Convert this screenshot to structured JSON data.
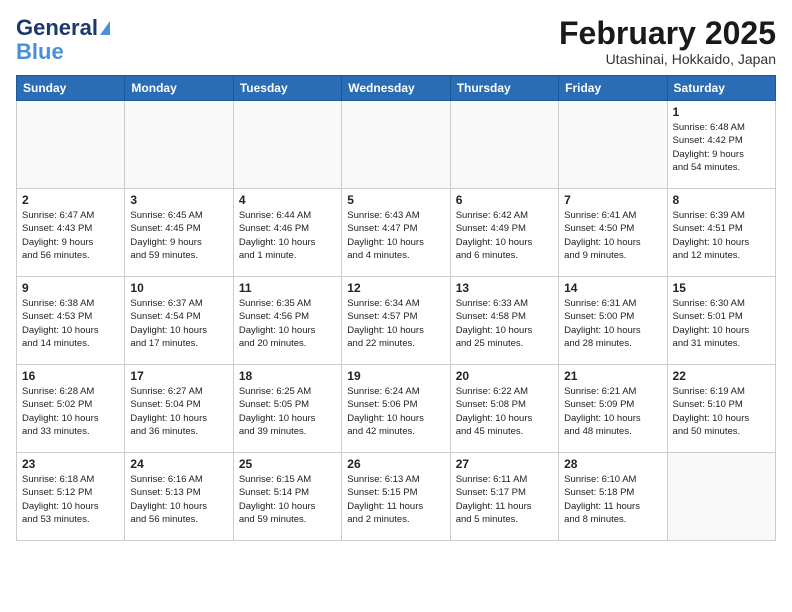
{
  "header": {
    "logo_line1": "General",
    "logo_line2": "Blue",
    "month_title": "February 2025",
    "location": "Utashinai, Hokkaido, Japan"
  },
  "days_of_week": [
    "Sunday",
    "Monday",
    "Tuesday",
    "Wednesday",
    "Thursday",
    "Friday",
    "Saturday"
  ],
  "weeks": [
    [
      {
        "day": "",
        "info": ""
      },
      {
        "day": "",
        "info": ""
      },
      {
        "day": "",
        "info": ""
      },
      {
        "day": "",
        "info": ""
      },
      {
        "day": "",
        "info": ""
      },
      {
        "day": "",
        "info": ""
      },
      {
        "day": "1",
        "info": "Sunrise: 6:48 AM\nSunset: 4:42 PM\nDaylight: 9 hours\nand 54 minutes."
      }
    ],
    [
      {
        "day": "2",
        "info": "Sunrise: 6:47 AM\nSunset: 4:43 PM\nDaylight: 9 hours\nand 56 minutes."
      },
      {
        "day": "3",
        "info": "Sunrise: 6:45 AM\nSunset: 4:45 PM\nDaylight: 9 hours\nand 59 minutes."
      },
      {
        "day": "4",
        "info": "Sunrise: 6:44 AM\nSunset: 4:46 PM\nDaylight: 10 hours\nand 1 minute."
      },
      {
        "day": "5",
        "info": "Sunrise: 6:43 AM\nSunset: 4:47 PM\nDaylight: 10 hours\nand 4 minutes."
      },
      {
        "day": "6",
        "info": "Sunrise: 6:42 AM\nSunset: 4:49 PM\nDaylight: 10 hours\nand 6 minutes."
      },
      {
        "day": "7",
        "info": "Sunrise: 6:41 AM\nSunset: 4:50 PM\nDaylight: 10 hours\nand 9 minutes."
      },
      {
        "day": "8",
        "info": "Sunrise: 6:39 AM\nSunset: 4:51 PM\nDaylight: 10 hours\nand 12 minutes."
      }
    ],
    [
      {
        "day": "9",
        "info": "Sunrise: 6:38 AM\nSunset: 4:53 PM\nDaylight: 10 hours\nand 14 minutes."
      },
      {
        "day": "10",
        "info": "Sunrise: 6:37 AM\nSunset: 4:54 PM\nDaylight: 10 hours\nand 17 minutes."
      },
      {
        "day": "11",
        "info": "Sunrise: 6:35 AM\nSunset: 4:56 PM\nDaylight: 10 hours\nand 20 minutes."
      },
      {
        "day": "12",
        "info": "Sunrise: 6:34 AM\nSunset: 4:57 PM\nDaylight: 10 hours\nand 22 minutes."
      },
      {
        "day": "13",
        "info": "Sunrise: 6:33 AM\nSunset: 4:58 PM\nDaylight: 10 hours\nand 25 minutes."
      },
      {
        "day": "14",
        "info": "Sunrise: 6:31 AM\nSunset: 5:00 PM\nDaylight: 10 hours\nand 28 minutes."
      },
      {
        "day": "15",
        "info": "Sunrise: 6:30 AM\nSunset: 5:01 PM\nDaylight: 10 hours\nand 31 minutes."
      }
    ],
    [
      {
        "day": "16",
        "info": "Sunrise: 6:28 AM\nSunset: 5:02 PM\nDaylight: 10 hours\nand 33 minutes."
      },
      {
        "day": "17",
        "info": "Sunrise: 6:27 AM\nSunset: 5:04 PM\nDaylight: 10 hours\nand 36 minutes."
      },
      {
        "day": "18",
        "info": "Sunrise: 6:25 AM\nSunset: 5:05 PM\nDaylight: 10 hours\nand 39 minutes."
      },
      {
        "day": "19",
        "info": "Sunrise: 6:24 AM\nSunset: 5:06 PM\nDaylight: 10 hours\nand 42 minutes."
      },
      {
        "day": "20",
        "info": "Sunrise: 6:22 AM\nSunset: 5:08 PM\nDaylight: 10 hours\nand 45 minutes."
      },
      {
        "day": "21",
        "info": "Sunrise: 6:21 AM\nSunset: 5:09 PM\nDaylight: 10 hours\nand 48 minutes."
      },
      {
        "day": "22",
        "info": "Sunrise: 6:19 AM\nSunset: 5:10 PM\nDaylight: 10 hours\nand 50 minutes."
      }
    ],
    [
      {
        "day": "23",
        "info": "Sunrise: 6:18 AM\nSunset: 5:12 PM\nDaylight: 10 hours\nand 53 minutes."
      },
      {
        "day": "24",
        "info": "Sunrise: 6:16 AM\nSunset: 5:13 PM\nDaylight: 10 hours\nand 56 minutes."
      },
      {
        "day": "25",
        "info": "Sunrise: 6:15 AM\nSunset: 5:14 PM\nDaylight: 10 hours\nand 59 minutes."
      },
      {
        "day": "26",
        "info": "Sunrise: 6:13 AM\nSunset: 5:15 PM\nDaylight: 11 hours\nand 2 minutes."
      },
      {
        "day": "27",
        "info": "Sunrise: 6:11 AM\nSunset: 5:17 PM\nDaylight: 11 hours\nand 5 minutes."
      },
      {
        "day": "28",
        "info": "Sunrise: 6:10 AM\nSunset: 5:18 PM\nDaylight: 11 hours\nand 8 minutes."
      },
      {
        "day": "",
        "info": ""
      }
    ]
  ]
}
